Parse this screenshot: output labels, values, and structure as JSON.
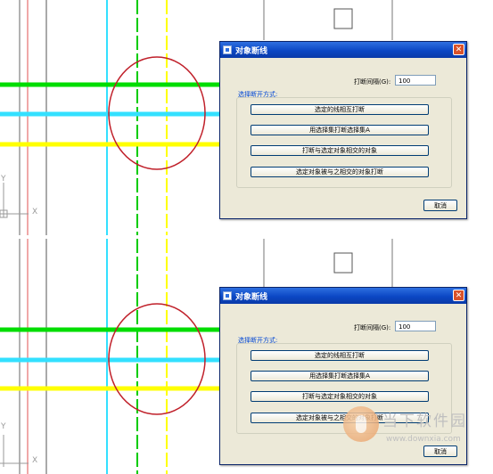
{
  "dialog": {
    "title": "对象断线",
    "close_label": "✕",
    "interval_label": "打断间隔(G):",
    "interval_value": "100",
    "group_label": "选择断开方式:",
    "options": [
      "选定的线相互打断",
      "用选择集打断选择集A",
      "打断与选定对象相交的对象",
      "选定对象被与之相交的对象打断"
    ],
    "cancel_label": "取消"
  },
  "cad": {
    "axis_y": "Y",
    "axis_x": "X"
  },
  "watermark": {
    "text": "当下软件园",
    "url": "www.downxia.com"
  },
  "colors": {
    "green": "#00dd00",
    "cyan": "#33e0ff",
    "yellow": "#ffff00",
    "red_circle": "#c0202a",
    "titlebar": "#0b47c4"
  }
}
